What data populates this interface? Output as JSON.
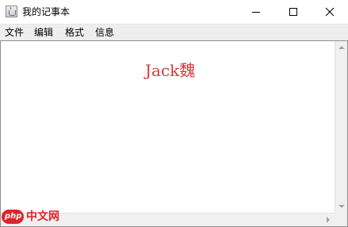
{
  "window": {
    "title": "我的记事本",
    "icon": "java-cup-icon"
  },
  "controls": {
    "minimize_icon": "minimize-icon",
    "maximize_icon": "maximize-icon",
    "close_icon": "close-icon"
  },
  "menu": {
    "items": [
      {
        "label": "文件"
      },
      {
        "label": "编辑"
      },
      {
        "label": "格式"
      },
      {
        "label": "信息"
      }
    ]
  },
  "editor": {
    "content": "Jack魏",
    "text_color": "#d33a3a"
  },
  "watermark": {
    "logo_text": "php",
    "site_text": "中文网",
    "color": "#e0242b"
  }
}
